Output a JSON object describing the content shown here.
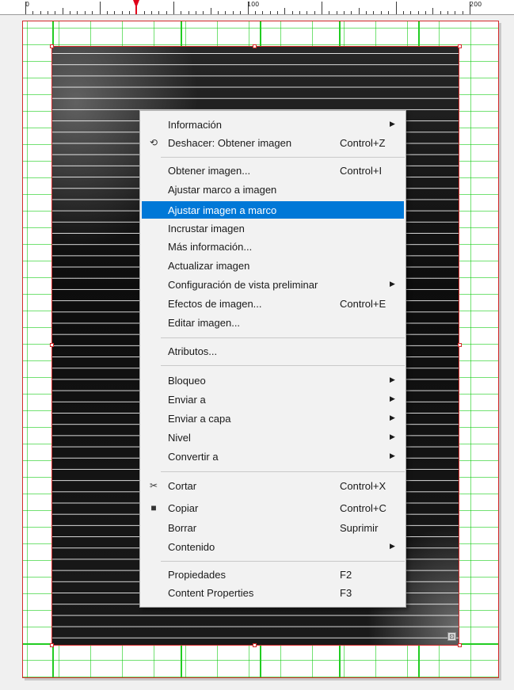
{
  "ruler": {
    "labels": [
      "0",
      "100",
      "200"
    ]
  },
  "frame": {
    "content_icon": "⊡"
  },
  "context_menu": {
    "items": [
      {
        "label": "Información",
        "shortcut": "",
        "submenu": true,
        "icon": ""
      },
      {
        "label": "Deshacer: Obtener imagen",
        "shortcut": "Control+Z",
        "submenu": false,
        "icon": "undo-icon"
      },
      {
        "label": "Obtener imagen...",
        "shortcut": "Control+I",
        "submenu": false,
        "icon": ""
      },
      {
        "label": "Ajustar marco a imagen",
        "shortcut": "",
        "submenu": false,
        "icon": ""
      },
      {
        "label": "Ajustar imagen a marco",
        "shortcut": "",
        "submenu": false,
        "icon": "",
        "highlighted": true
      },
      {
        "label": "Incrustar imagen",
        "shortcut": "",
        "submenu": false,
        "icon": ""
      },
      {
        "label": "Más información...",
        "shortcut": "",
        "submenu": false,
        "icon": ""
      },
      {
        "label": "Actualizar imagen",
        "shortcut": "",
        "submenu": false,
        "icon": ""
      },
      {
        "label": "Configuración de vista preliminar",
        "shortcut": "",
        "submenu": true,
        "icon": ""
      },
      {
        "label": "Efectos de imagen...",
        "shortcut": "Control+E",
        "submenu": false,
        "icon": ""
      },
      {
        "label": "Editar imagen...",
        "shortcut": "",
        "submenu": false,
        "icon": ""
      },
      {
        "label": "Atributos...",
        "shortcut": "",
        "submenu": false,
        "icon": ""
      },
      {
        "label": "Bloqueo",
        "shortcut": "",
        "submenu": true,
        "icon": ""
      },
      {
        "label": "Enviar a",
        "shortcut": "",
        "submenu": true,
        "icon": ""
      },
      {
        "label": "Enviar a capa",
        "shortcut": "",
        "submenu": true,
        "icon": ""
      },
      {
        "label": "Nivel",
        "shortcut": "",
        "submenu": true,
        "icon": ""
      },
      {
        "label": "Convertir a",
        "shortcut": "",
        "submenu": true,
        "icon": ""
      },
      {
        "label": "Cortar",
        "shortcut": "Control+X",
        "submenu": false,
        "icon": "scissors-icon"
      },
      {
        "label": "Copiar",
        "shortcut": "Control+C",
        "submenu": false,
        "icon": "copy-icon"
      },
      {
        "label": "Borrar",
        "shortcut": "Suprimir",
        "submenu": false,
        "icon": ""
      },
      {
        "label": "Contenido",
        "shortcut": "",
        "submenu": true,
        "icon": ""
      },
      {
        "label": "Propiedades",
        "shortcut": "F2",
        "submenu": false,
        "icon": ""
      },
      {
        "label": "Content Properties",
        "shortcut": "F3",
        "submenu": false,
        "icon": ""
      }
    ],
    "highlight_color": "#0078d7"
  },
  "colors": {
    "frame_border": "#d42a2a",
    "grid": "#22cc22",
    "marker": "#e0001a"
  }
}
